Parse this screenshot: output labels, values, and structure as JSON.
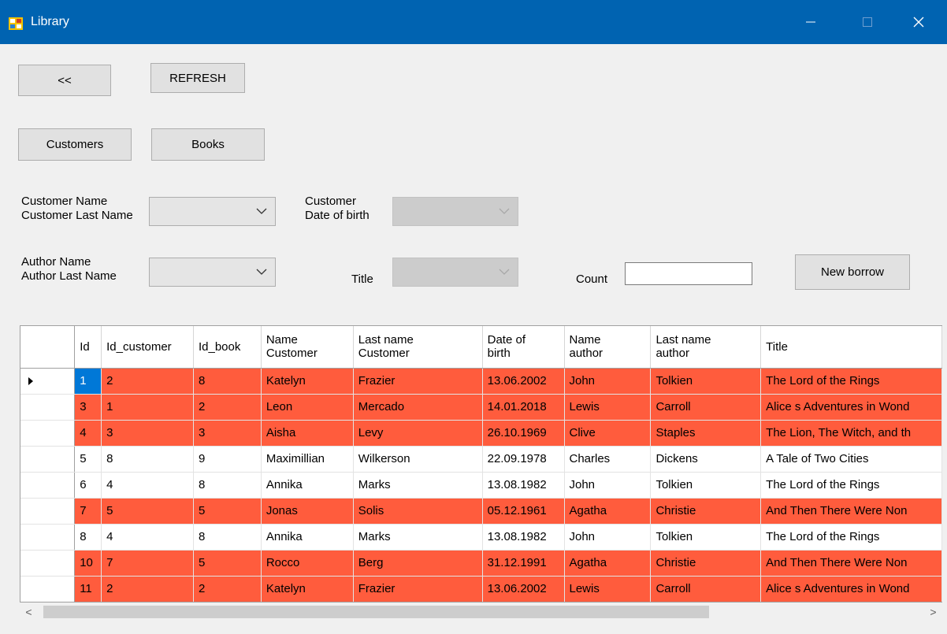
{
  "window": {
    "title": "Library",
    "colors": {
      "titlebar": "#0063b1",
      "overdue_row": "#ff5c3d",
      "selection": "#0078d7"
    }
  },
  "toolbar": {
    "back_label": "<<",
    "refresh_label": "REFRESH",
    "customers_label": "Customers",
    "books_label": "Books",
    "new_borrow_label": "New borrow"
  },
  "filters": {
    "customer_name_label_1": "Customer Name",
    "customer_name_label_2": "Customer Last Name",
    "customer_dob_label_1": "Customer",
    "customer_dob_label_2": "Date of birth",
    "author_label_1": "Author Name",
    "author_label_2": "Author Last Name",
    "title_label": "Title",
    "count_label": "Count",
    "count_value": ""
  },
  "grid": {
    "columns": [
      {
        "label": "Id"
      },
      {
        "label": "Id_customer"
      },
      {
        "label": "Id_book"
      },
      {
        "label": "Name Customer"
      },
      {
        "label": "Last name Customer"
      },
      {
        "label": "Date of birth"
      },
      {
        "label": "Name author"
      },
      {
        "label": "Last name author"
      },
      {
        "label": "Title"
      }
    ],
    "rows": [
      {
        "overdue": true,
        "selected_cell": 0,
        "cells": [
          "1",
          "2",
          "8",
          "Katelyn",
          "Frazier",
          "13.06.2002",
          "John",
          "Tolkien",
          "The Lord of the Rings"
        ]
      },
      {
        "overdue": true,
        "cells": [
          "3",
          "1",
          "2",
          "Leon",
          "Mercado",
          "14.01.2018",
          "Lewis",
          "Carroll",
          "Alice s Adventures in Wond"
        ]
      },
      {
        "overdue": true,
        "cells": [
          "4",
          "3",
          "3",
          "Aisha",
          "Levy",
          "26.10.1969",
          "Clive",
          "Staples",
          "The Lion, The Witch, and th"
        ]
      },
      {
        "overdue": false,
        "cells": [
          "5",
          "8",
          "9",
          "Maximillian",
          "Wilkerson",
          "22.09.1978",
          "Charles",
          "Dickens",
          "A Tale of Two Cities"
        ]
      },
      {
        "overdue": false,
        "cells": [
          "6",
          "4",
          "8",
          "Annika",
          "Marks",
          "13.08.1982",
          "John",
          "Tolkien",
          "The Lord of the Rings"
        ]
      },
      {
        "overdue": true,
        "cells": [
          "7",
          "5",
          "5",
          "Jonas",
          "Solis",
          "05.12.1961",
          "Agatha",
          "Christie",
          "And Then There Were Non"
        ]
      },
      {
        "overdue": false,
        "cells": [
          "8",
          "4",
          "8",
          "Annika",
          "Marks",
          "13.08.1982",
          "John",
          "Tolkien",
          "The Lord of the Rings"
        ]
      },
      {
        "overdue": true,
        "cells": [
          "10",
          "7",
          "5",
          "Rocco",
          "Berg",
          "31.12.1991",
          "Agatha",
          "Christie",
          "And Then There Were Non"
        ]
      },
      {
        "overdue": true,
        "cells": [
          "11",
          "2",
          "2",
          "Katelyn",
          "Frazier",
          "13.06.2002",
          "Lewis",
          "Carroll",
          "Alice s Adventures in Wond"
        ]
      }
    ]
  },
  "scrollbar": {
    "left_arrow": "<",
    "right_arrow": ">"
  }
}
